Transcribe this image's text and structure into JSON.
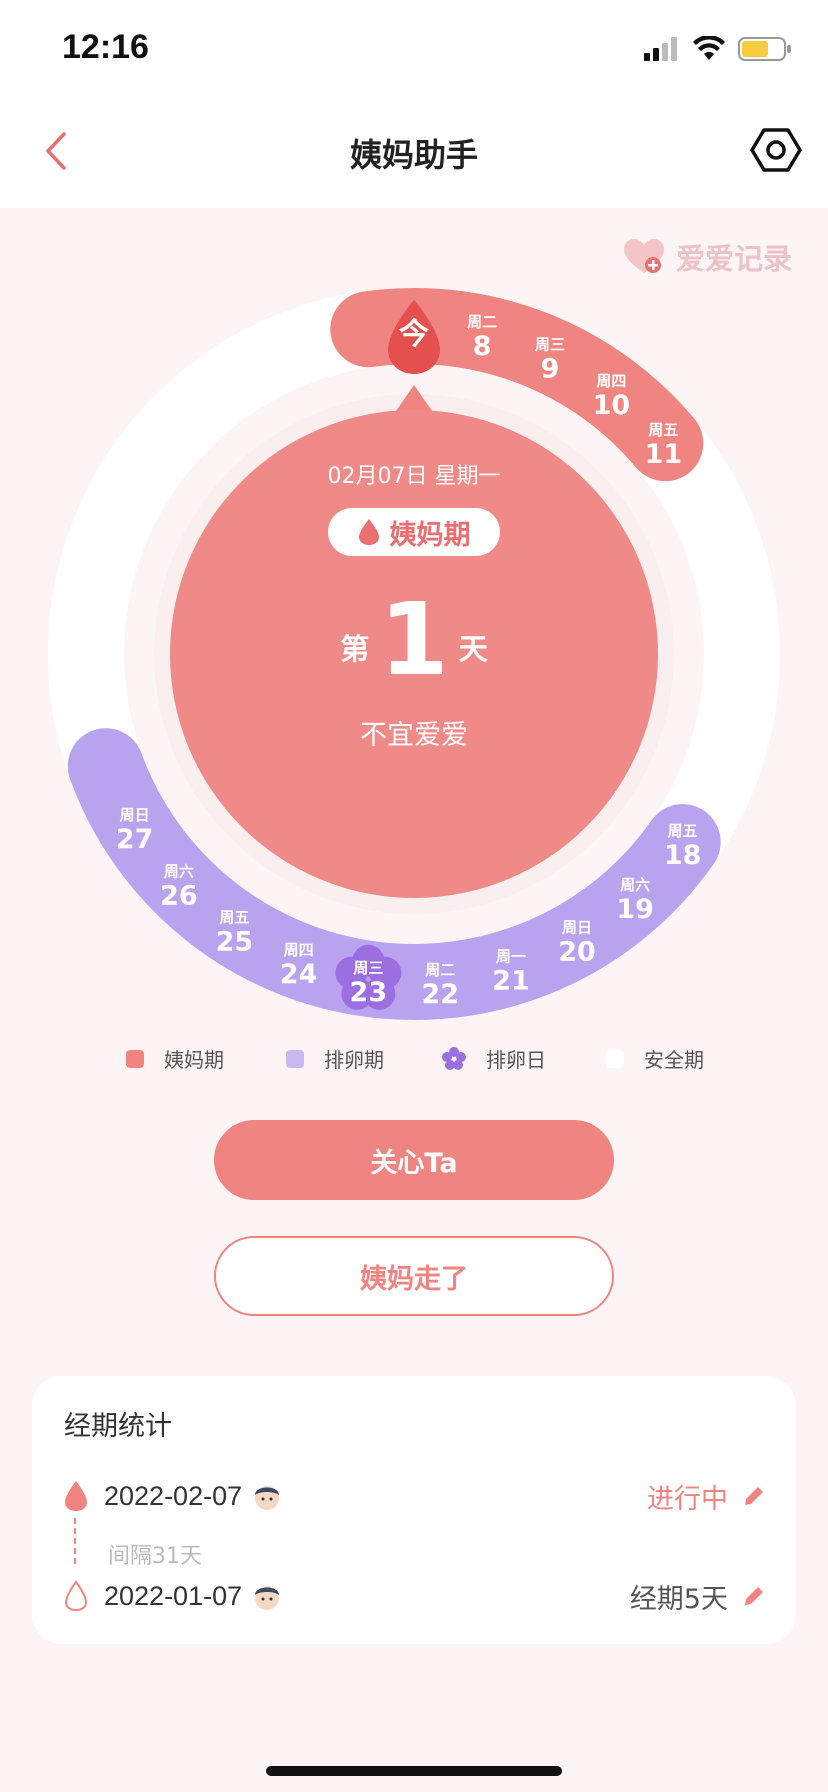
{
  "status_bar": {
    "time": "12:16"
  },
  "nav": {
    "title": "姨妈助手"
  },
  "love_record": {
    "label": "爱爱记录"
  },
  "today": {
    "badge": "今",
    "date": "02月07日 星期一",
    "phase_label": "姨妈期",
    "day_prefix": "第",
    "day_number": "1",
    "day_suffix": "天",
    "advice": "不宜爱爱"
  },
  "period_days": [
    {
      "weekday": "周二",
      "day": "8"
    },
    {
      "weekday": "周三",
      "day": "9"
    },
    {
      "weekday": "周四",
      "day": "10"
    },
    {
      "weekday": "周五",
      "day": "11"
    }
  ],
  "ovulation_days": [
    {
      "weekday": "周五",
      "day": "18"
    },
    {
      "weekday": "周六",
      "day": "19"
    },
    {
      "weekday": "周日",
      "day": "20"
    },
    {
      "weekday": "周一",
      "day": "21"
    },
    {
      "weekday": "周二",
      "day": "22"
    },
    {
      "weekday": "周三",
      "day": "23",
      "is_ovulation_day": true
    },
    {
      "weekday": "周四",
      "day": "24"
    },
    {
      "weekday": "周五",
      "day": "25"
    },
    {
      "weekday": "周六",
      "day": "26"
    },
    {
      "weekday": "周日",
      "day": "27"
    }
  ],
  "legend": {
    "period": "姨妈期",
    "ovulation_phase": "排卵期",
    "ovulation_day": "排卵日",
    "safe": "安全期"
  },
  "buttons": {
    "care": "关心Ta",
    "period_end": "姨妈走了"
  },
  "stats": {
    "title": "经期统计",
    "records": [
      {
        "date": "2022-02-07",
        "status": "进行中",
        "status_color": "#ef8480"
      },
      {
        "date": "2022-01-07",
        "status": "经期5天",
        "status_color": "#555555"
      }
    ],
    "interval": "间隔31天"
  },
  "colors": {
    "period": "#ef8480",
    "ovulation_phase": "#b9a3ef",
    "ovulation_day": "#9b6fe0",
    "safe": "#ffffff",
    "background": "#fdf5f5"
  }
}
